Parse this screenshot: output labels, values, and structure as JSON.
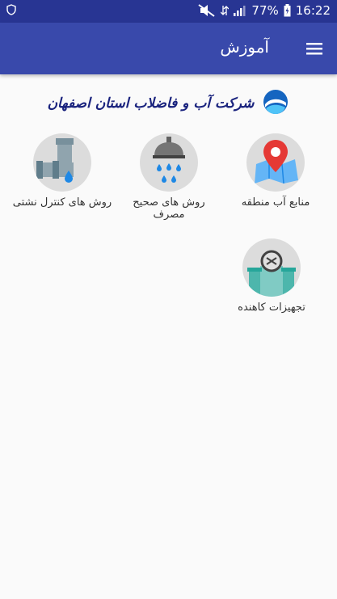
{
  "status_bar": {
    "left_icon": "shield-notification-icon",
    "battery_percent": "77%",
    "time": "16:22"
  },
  "app_bar": {
    "title": "آموزش",
    "menu_icon": "hamburger-menu-icon"
  },
  "banner": {
    "company_name": "شرکت آب و فاضلاب استان اصفهان"
  },
  "tiles": [
    {
      "label": "منابع آب منطقه",
      "icon": "map-pin-icon"
    },
    {
      "label": "روش های صحیح مصرف",
      "icon": "shower-head-icon"
    },
    {
      "label": "روش های کنترل نشتی",
      "icon": "leaking-pipe-icon"
    },
    {
      "label": "تجهیزات کاهنده",
      "icon": "pipe-gauge-icon"
    }
  ],
  "colors": {
    "status_bar": "#283593",
    "app_bar": "#3949ab",
    "background": "#fafafa",
    "tile_circle": "#dcdcdc"
  }
}
